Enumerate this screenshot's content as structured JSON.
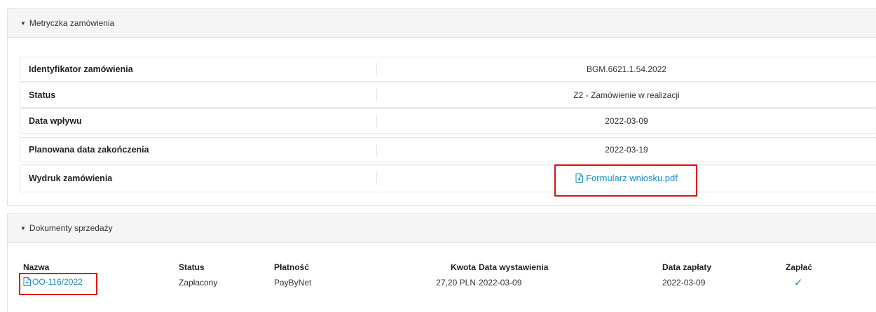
{
  "metryczka": {
    "title": "Metryczka zamówienia",
    "rows": [
      {
        "label": "Identyfikator zamówienia",
        "value": "BGM.6621.1.54.2022"
      },
      {
        "label": "Status",
        "value": "Z2 - Zamówienie w realizacji"
      },
      {
        "label": "Data wpływu",
        "value": "2022-03-09"
      },
      {
        "label": "Planowana data zakończenia",
        "value": "2022-03-19"
      },
      {
        "label": "Wydruk zamówienia",
        "value": "Formularz wniosku.pdf"
      }
    ]
  },
  "dokumenty": {
    "title": "Dokumenty sprzedaży",
    "columns": {
      "nazwa": "Nazwa",
      "status": "Status",
      "platnosc": "Płatność",
      "kwota": "Kwota",
      "data_wystawienia": "Data wystawienia",
      "data_zaplaty": "Data zapłaty",
      "zaplac": "Zapłać"
    },
    "rows": [
      {
        "nazwa": "OO-116/2022",
        "status": "Zapłacony",
        "platnosc": "PayByNet",
        "kwota": "27,20 PLN",
        "data_wystawienia": "2022-03-09",
        "data_zaplaty": "2022-03-09",
        "zaplac": "✓"
      }
    ]
  },
  "colors": {
    "link": "#1a8ac6",
    "highlight": "#e01010",
    "header_bg": "#f5f5f5"
  },
  "icons": [
    "caret-down-icon",
    "pdf-file-icon",
    "checkmark-icon"
  ]
}
